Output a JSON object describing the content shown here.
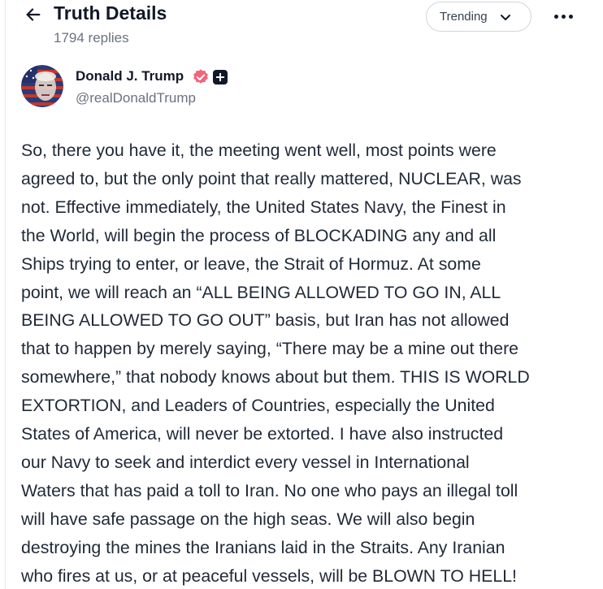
{
  "header": {
    "title": "Truth Details",
    "reply_count": "1794 replies",
    "sort_label": "Trending",
    "back_icon": "arrow-left-icon",
    "more_icon": "more-horizontal-icon"
  },
  "author": {
    "name": "Donald J. Trump",
    "handle": "@realDonaldTrump",
    "verified_color": "#f0657a",
    "badge_icon": "plus-badge-icon"
  },
  "post": {
    "lines": [
      "So, there you have it, the meeting went well, most points were",
      "agreed to, but the only point that really mattered, NUCLEAR, was",
      "not. Effective immediately, the United States Navy, the Finest in",
      "the World, will begin the process of BLOCKADING any and all",
      "Ships trying to enter, or leave, the Strait of Hormuz. At some",
      "point, we will reach an “ALL BEING ALLOWED TO GO IN, ALL",
      "BEING ALLOWED TO GO OUT” basis, but Iran has not allowed",
      "that to happen by merely saying, “There may be a mine out there",
      "somewhere,” that nobody knows about but them. THIS IS WORLD",
      "EXTORTION, and Leaders of Countries, especially the United",
      "States of America, will never be extorted. I have also instructed",
      "our Navy to seek and interdict every vessel in International",
      "Waters that has paid a toll to Iran. No one who pays an illegal toll",
      "will have safe passage on the high seas. We will also begin",
      "destroying the mines the Iranians laid in the Straits. Any Iranian",
      "who fires at us, or at peaceful vessels, will be BLOWN TO HELL!"
    ]
  }
}
